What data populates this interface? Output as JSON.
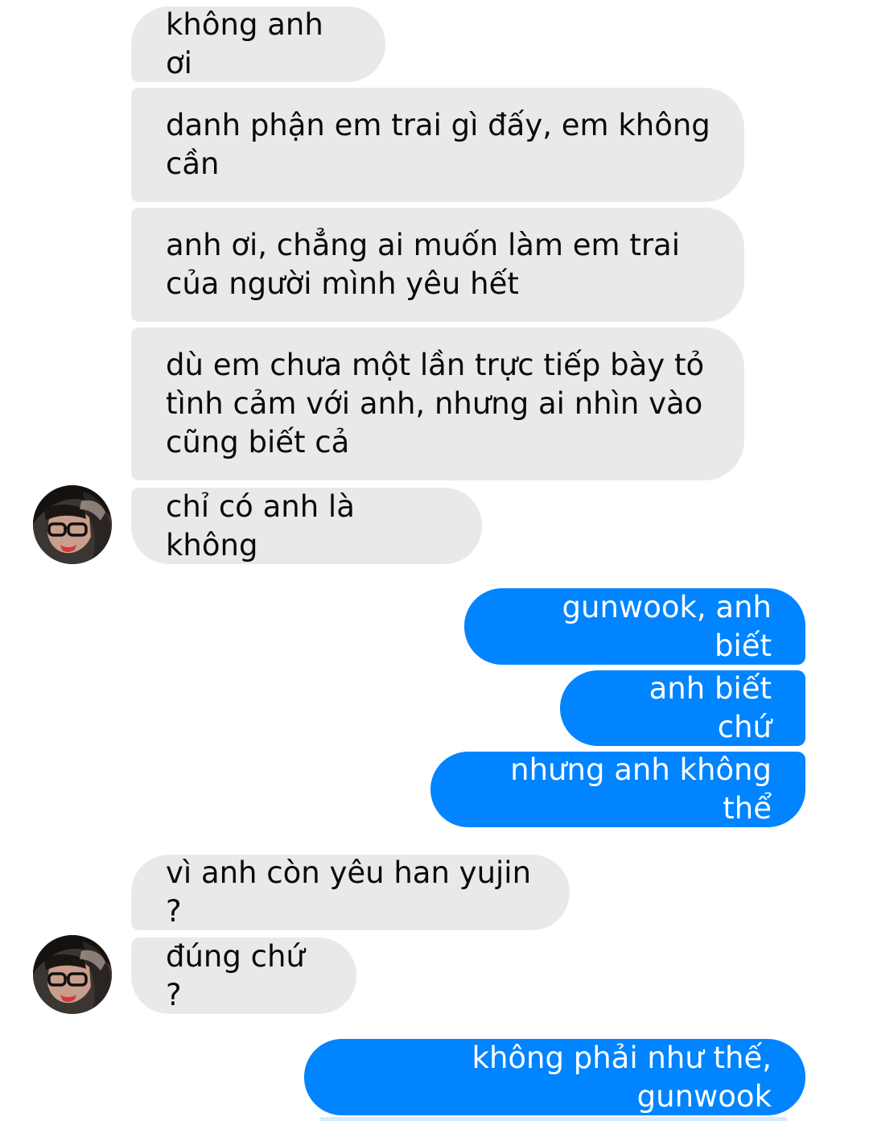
{
  "messages": [
    {
      "sender": "them",
      "text": "không anh ơi"
    },
    {
      "sender": "them",
      "text": "danh phận em trai gì đấy, em không cần"
    },
    {
      "sender": "them",
      "text": "anh ơi, chẳng ai muốn làm em trai của người mình yêu hết"
    },
    {
      "sender": "them",
      "text": "dù em chưa một lần trực tiếp bày tỏ tình cảm với anh, nhưng ai nhìn vào cũng biết cả"
    },
    {
      "sender": "them",
      "text": "chỉ có anh là không"
    },
    {
      "sender": "me",
      "text": "gunwook, anh biết"
    },
    {
      "sender": "me",
      "text": "anh biết chứ"
    },
    {
      "sender": "me",
      "text": "nhưng anh không thể"
    },
    {
      "sender": "them",
      "text": "vì anh còn yêu han yujin ?"
    },
    {
      "sender": "them",
      "text": "đúng chứ ?"
    },
    {
      "sender": "me",
      "text": "không phải như thế, gunwook"
    }
  ],
  "theme": {
    "incoming_bubble": "#e9e9eb",
    "outgoing_bubble": "#0084ff",
    "incoming_text": "#0a0a0a",
    "outgoing_text": "#ffffff"
  },
  "icons": {
    "avatar": "contact-avatar-photo"
  }
}
